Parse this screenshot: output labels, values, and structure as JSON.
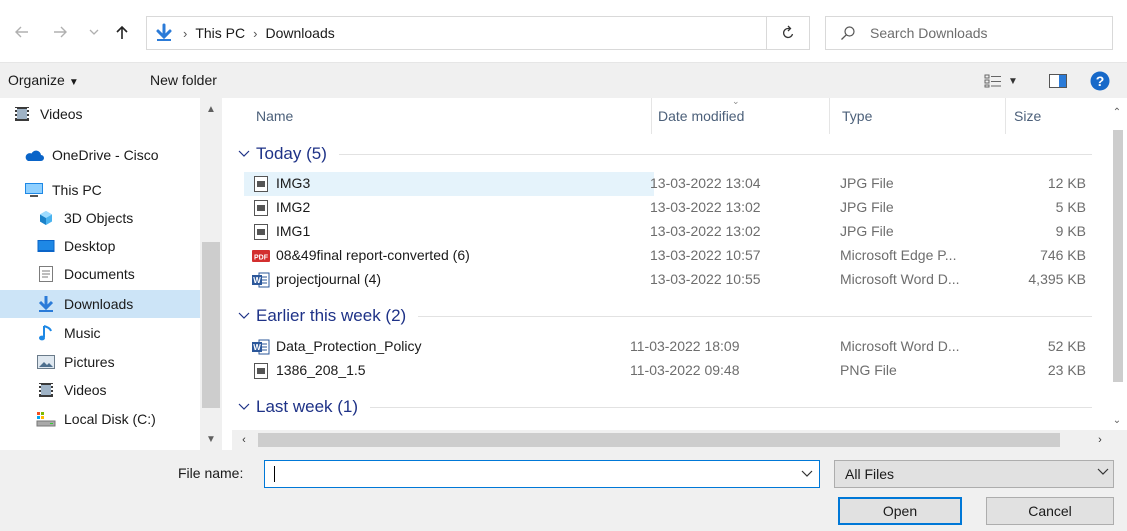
{
  "address_bar": {
    "breadcrumbs": [
      "This PC",
      "Downloads"
    ],
    "search_placeholder": "Search Downloads"
  },
  "toolbar": {
    "organize_label": "Organize",
    "new_folder_label": "New folder"
  },
  "nav_pane": {
    "items": [
      {
        "label": "Videos",
        "icon": "videos-folder-icon"
      },
      {
        "label": "OneDrive - Cisco",
        "icon": "onedrive-cloud-icon"
      },
      {
        "label": "This PC",
        "icon": "this-pc-icon"
      },
      {
        "label": "3D Objects",
        "icon": "3d-objects-icon"
      },
      {
        "label": "Desktop",
        "icon": "desktop-icon"
      },
      {
        "label": "Documents",
        "icon": "documents-icon"
      },
      {
        "label": "Downloads",
        "icon": "downloads-icon",
        "selected": true
      },
      {
        "label": "Music",
        "icon": "music-icon"
      },
      {
        "label": "Pictures",
        "icon": "pictures-icon"
      },
      {
        "label": "Videos",
        "icon": "videos-folder-icon"
      },
      {
        "label": "Local Disk (C:)",
        "icon": "local-disk-icon"
      }
    ]
  },
  "file_list": {
    "columns": [
      "Name",
      "Date modified",
      "Type",
      "Size"
    ],
    "groups": [
      {
        "label": "Today (5)",
        "files": [
          {
            "name": "IMG3",
            "date": "13-03-2022 13:04",
            "type": "JPG File",
            "size": "12 KB",
            "icon": "image-file-icon",
            "selected": true
          },
          {
            "name": "IMG2",
            "date": "13-03-2022 13:02",
            "type": "JPG File",
            "size": "5 KB",
            "icon": "image-file-icon"
          },
          {
            "name": "IMG1",
            "date": "13-03-2022 13:02",
            "type": "JPG File",
            "size": "9 KB",
            "icon": "image-file-icon"
          },
          {
            "name": "08&49final report-converted (6)",
            "date": "13-03-2022 10:57",
            "type": "Microsoft Edge P...",
            "size": "746 KB",
            "icon": "pdf-file-icon"
          },
          {
            "name": "projectjournal (4)",
            "date": "13-03-2022 10:55",
            "type": "Microsoft Word D...",
            "size": "4,395 KB",
            "icon": "word-file-icon"
          }
        ]
      },
      {
        "label": "Earlier this week (2)",
        "files": [
          {
            "name": "Data_Protection_Policy",
            "date": "11-03-2022 18:09",
            "type": "Microsoft Word D...",
            "size": "52 KB",
            "icon": "word-file-icon"
          },
          {
            "name": "1386_208_1.5",
            "date": "11-03-2022 09:48",
            "type": "PNG File",
            "size": "23 KB",
            "icon": "image-file-icon"
          }
        ]
      },
      {
        "label": "Last week (1)",
        "files": []
      }
    ]
  },
  "footer": {
    "file_name_label": "File name:",
    "file_name_value": "",
    "file_type_filter": "All Files",
    "open_label": "Open",
    "cancel_label": "Cancel"
  },
  "colors": {
    "accent": "#0078d7",
    "selection": "#cce4f7",
    "group_header": "#1e3287",
    "column_header": "#4c607a"
  }
}
